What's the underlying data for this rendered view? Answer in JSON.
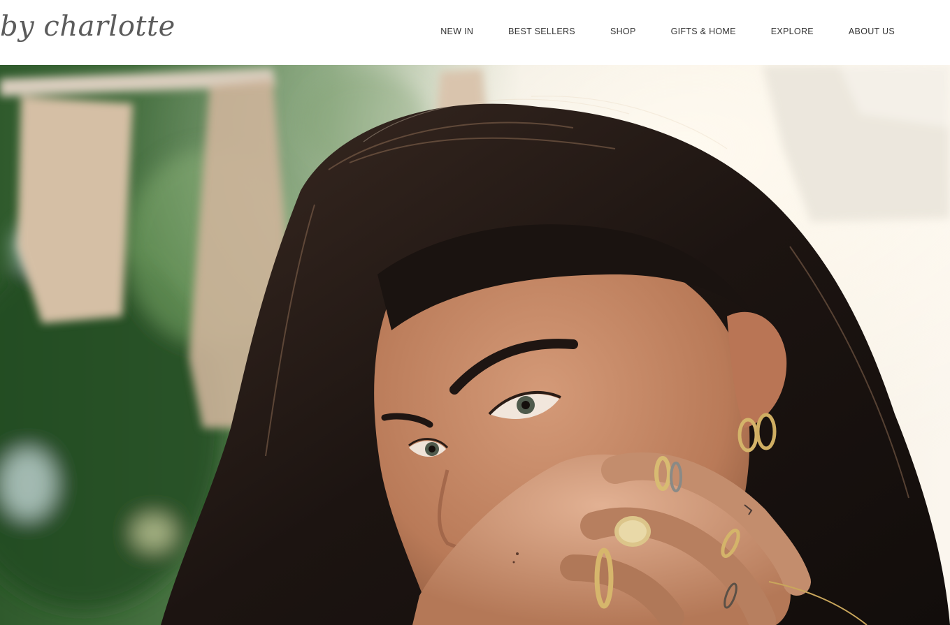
{
  "header": {
    "logo": "by charlotte",
    "nav": [
      {
        "label": "NEW IN"
      },
      {
        "label": "BEST SELLERS"
      },
      {
        "label": "SHOP"
      },
      {
        "label": "GIFTS & HOME"
      },
      {
        "label": "EXPLORE"
      },
      {
        "label": "ABOUT US"
      }
    ]
  },
  "hero": {
    "image": "woman-with-gold-jewelry-photo"
  },
  "colors": {
    "background": "#ffffff",
    "logo": "#5b5b5b",
    "nav_text": "#333333",
    "hair": "#1e1714",
    "skin": "#c68b6b",
    "gold": "#d4b46a",
    "foliage": "#3f6b34"
  }
}
